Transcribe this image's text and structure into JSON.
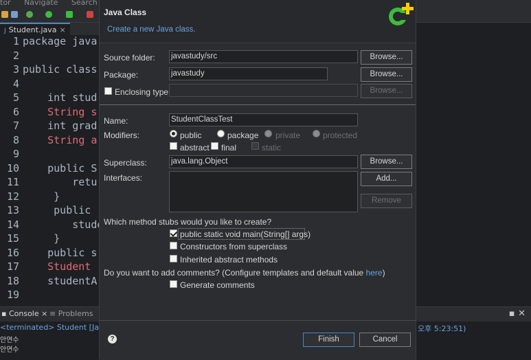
{
  "ide": {
    "menu": [
      "tor",
      "Navigate",
      "Search"
    ],
    "editor_tab": "Student.java",
    "code_lines": [
      {
        "n": "1",
        "text": "package java"
      },
      {
        "n": "2",
        "text": ""
      },
      {
        "n": "3",
        "text": "public class"
      },
      {
        "n": "4",
        "text": ""
      },
      {
        "n": "5",
        "text": "    int stud"
      },
      {
        "n": "6",
        "text": "    String s"
      },
      {
        "n": "7",
        "text": "    int grad"
      },
      {
        "n": "8",
        "text": "    String a"
      },
      {
        "n": "9",
        "text": ""
      },
      {
        "n": "10",
        "text": "    public S"
      },
      {
        "n": "11",
        "text": "        retur"
      },
      {
        "n": "12",
        "text": "     }"
      },
      {
        "n": "13",
        "text": "     public"
      },
      {
        "n": "14",
        "text": "        stude"
      },
      {
        "n": "15",
        "text": "     }"
      },
      {
        "n": "16",
        "text": "    public s"
      },
      {
        "n": "17",
        "text": "    Student"
      },
      {
        "n": "18",
        "text": "    studentA"
      },
      {
        "n": "19",
        "text": ""
      }
    ],
    "console_tab": "Console",
    "problems_tab": "Problems",
    "terminated": "<terminated> Student [Java",
    "time_text": "오후 5:23:51)",
    "output": [
      "안연수",
      "안연수"
    ]
  },
  "dialog": {
    "title": "Java Class",
    "subtitle": "Create a new Java class.",
    "source_folder_label": "Source folder:",
    "source_folder_value": "javastudy/src",
    "package_label": "Package:",
    "package_value": "javastudy",
    "enclosing_label": "Enclosing type:",
    "enclosing_value": "",
    "browse_label": "Browse...",
    "name_label": "Name:",
    "name_value": "StudentClassTest",
    "modifiers_label": "Modifiers:",
    "mod_public": "public",
    "mod_package": "package",
    "mod_private": "private",
    "mod_protected": "protected",
    "mod_abstract": "abstract",
    "mod_final": "final",
    "mod_static": "static",
    "superclass_label": "Superclass:",
    "superclass_value": "java.lang.Object",
    "interfaces_label": "Interfaces:",
    "add_label": "Add...",
    "remove_label": "Remove",
    "stubs_question": "Which method stubs would you like to create?",
    "stub_main": "public static void main(String[] args)",
    "stub_constructors": "Constructors from superclass",
    "stub_inherited": "Inherited abstract methods",
    "comments_question_pre": "Do you want to add comments? (Configure templates and default value ",
    "comments_link": "here",
    "comments_question_post": ")",
    "generate_comments": "Generate comments",
    "finish_label": "Finish",
    "cancel_label": "Cancel",
    "help_glyph": "?"
  },
  "colors": {
    "accent": "#6aa3e0",
    "logo_green": "#3cbc3c",
    "logo_yellow": "#f5d000"
  }
}
